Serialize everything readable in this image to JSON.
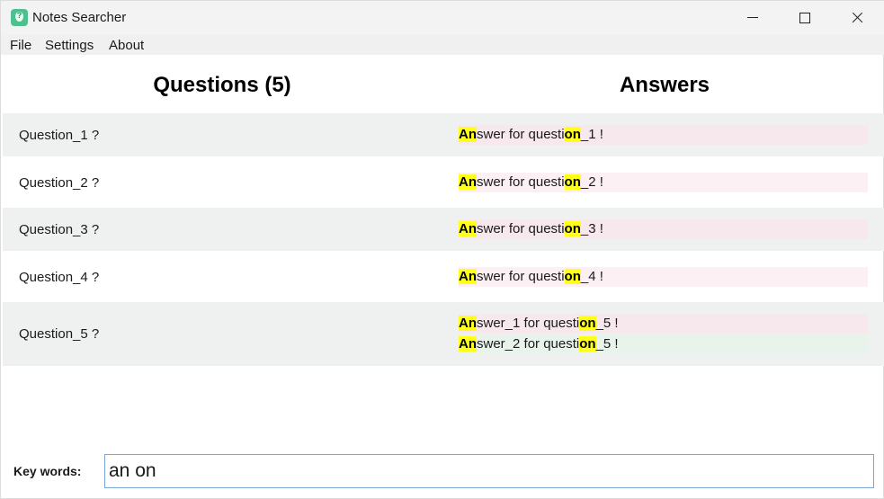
{
  "window": {
    "title": "Notes Searcher",
    "icon": "note-question-icon"
  },
  "menu": {
    "file": "File",
    "settings": "Settings",
    "about": "About"
  },
  "headers": {
    "questions": "Questions (5)",
    "answers": "Answers"
  },
  "rows": [
    {
      "question": "Question_1 ?",
      "answers": [
        {
          "hl1": "An",
          "mid": "swer for questi",
          "hl2": "on",
          "end": "_1 !"
        }
      ]
    },
    {
      "question": "Question_2 ?",
      "answers": [
        {
          "hl1": "An",
          "mid": "swer for questi",
          "hl2": "on",
          "end": "_2 !"
        }
      ]
    },
    {
      "question": "Question_3 ?",
      "answers": [
        {
          "hl1": "An",
          "mid": "swer for questi",
          "hl2": "on",
          "end": "_3 !"
        }
      ]
    },
    {
      "question": "Question_4 ?",
      "answers": [
        {
          "hl1": "An",
          "mid": "swer for questi",
          "hl2": "on",
          "end": "_4 !"
        }
      ]
    },
    {
      "question": "Question_5 ?",
      "answers": [
        {
          "hl1": "An",
          "mid": "swer_1 for questi",
          "hl2": "on",
          "end": "_5 !"
        },
        {
          "hl1": "An",
          "mid": "swer_2 for questi",
          "hl2": "on",
          "end": "_5 !"
        }
      ]
    }
  ],
  "search": {
    "label": "Key words:",
    "value": "an on"
  },
  "colors": {
    "highlight": "#ffff1a",
    "row_alt": "#eff0f0",
    "answer_pink": "#fdf0f4",
    "answer_green": "#e8f3ec",
    "input_border": "#7aa7d6"
  }
}
